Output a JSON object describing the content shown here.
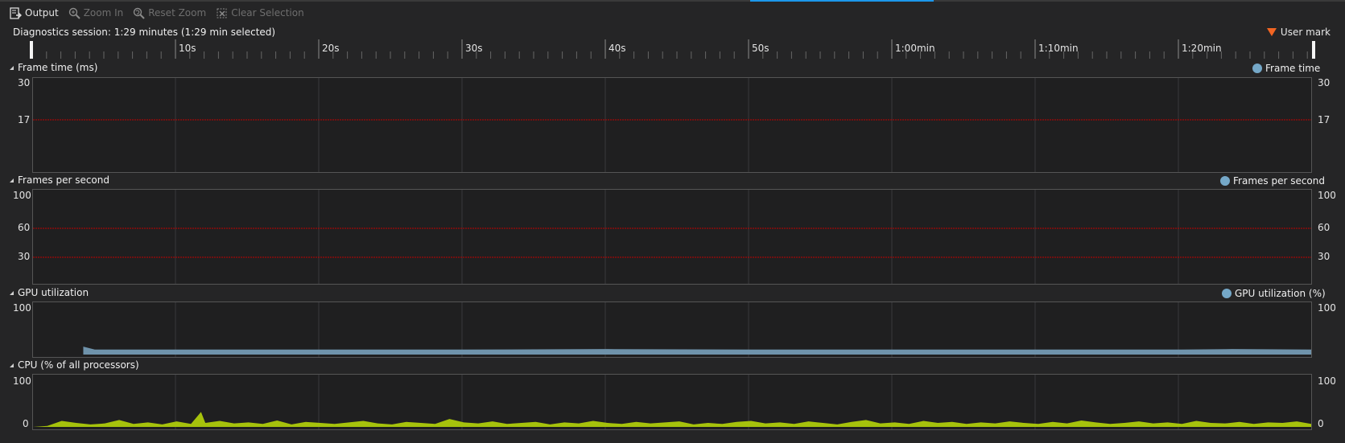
{
  "toolbar": {
    "output": "Output",
    "zoom_in": "Zoom In",
    "reset_zoom": "Reset Zoom",
    "clear_selection": "Clear Selection"
  },
  "session": {
    "label": "Diagnostics session: 1:29 minutes (1:29 min selected)",
    "user_mark": "User mark"
  },
  "ruler": {
    "ticks": [
      "10s",
      "20s",
      "30s",
      "40s",
      "50s",
      "1:00min",
      "1:10min",
      "1:20min"
    ]
  },
  "panels": {
    "frame_time": {
      "title": "Frame time (ms)",
      "legend": "Frame time",
      "y_top": "30",
      "y_ref": "17"
    },
    "fps": {
      "title": "Frames per second",
      "legend": "Frames per second",
      "y_top": "100",
      "y_ref1": "60",
      "y_ref2": "30"
    },
    "gpu": {
      "title": "GPU utilization",
      "legend": "GPU utilization (%)",
      "y_top": "100"
    },
    "cpu": {
      "title": "CPU (% of all processors)",
      "y_top": "100",
      "y_bottom": "0"
    }
  },
  "colors": {
    "gpu_fill": "#6f93ab",
    "cpu_fill": "#a6c20c",
    "reference_line": "#c00000",
    "accent": "#1c97ea",
    "user_mark": "#f26522"
  },
  "chart_data": [
    {
      "type": "area",
      "title": "GPU utilization",
      "legend": "GPU utilization (%)",
      "ylim": [
        0,
        100
      ],
      "x": [
        3.5,
        4.3,
        10,
        20,
        30,
        40,
        50,
        60,
        70,
        80,
        83.5,
        89
      ],
      "values": [
        16,
        10,
        10,
        10,
        10,
        11,
        10,
        10,
        10,
        10,
        11,
        10
      ]
    },
    {
      "type": "area",
      "title": "CPU (% of all processors)",
      "ylim": [
        0,
        100
      ],
      "x": [
        0,
        1,
        2,
        3,
        4,
        5,
        6,
        7,
        8,
        9,
        10,
        11,
        11.7,
        12,
        13,
        14,
        15,
        16,
        17,
        18,
        19,
        20,
        21,
        22,
        23,
        24,
        25,
        26,
        27,
        28,
        29,
        30,
        31,
        32,
        33,
        34,
        35,
        36,
        37,
        38,
        39,
        40,
        41,
        42,
        43,
        44,
        45,
        46,
        47,
        48,
        49,
        50,
        51,
        52,
        53,
        54,
        55,
        56,
        57,
        58,
        59,
        60,
        61,
        62,
        63,
        64,
        65,
        66,
        67,
        68,
        69,
        70,
        71,
        72,
        73,
        74,
        75,
        76,
        77,
        78,
        79,
        80,
        81,
        82,
        83,
        84,
        85,
        86,
        87,
        88,
        89
      ],
      "values": [
        0,
        2,
        12,
        8,
        5,
        7,
        14,
        6,
        9,
        5,
        11,
        6,
        30,
        8,
        12,
        7,
        9,
        6,
        13,
        5,
        10,
        8,
        6,
        9,
        12,
        7,
        5,
        10,
        8,
        6,
        16,
        9,
        7,
        11,
        6,
        8,
        10,
        5,
        9,
        7,
        12,
        8,
        6,
        10,
        7,
        9,
        11,
        5,
        8,
        6,
        10,
        12,
        7,
        9,
        6,
        11,
        8,
        5,
        10,
        14,
        7,
        9,
        6,
        12,
        8,
        10,
        6,
        9,
        7,
        11,
        8,
        6,
        10,
        7,
        13,
        9,
        6,
        8,
        11,
        7,
        9,
        6,
        12,
        8,
        7,
        10,
        6,
        9,
        8,
        11,
        6
      ]
    }
  ]
}
